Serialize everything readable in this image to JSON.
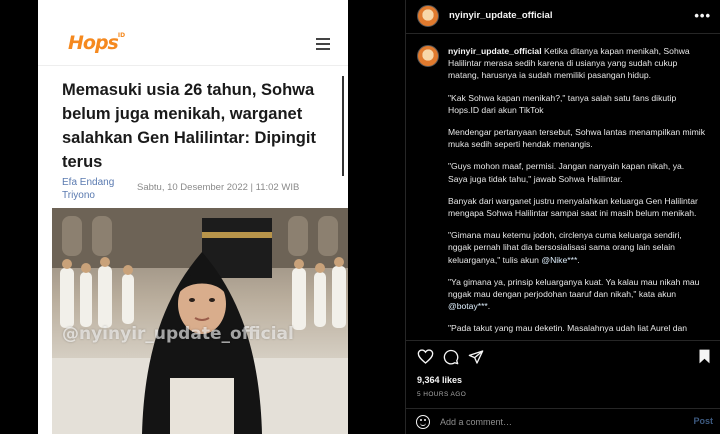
{
  "article": {
    "logo": "Hops",
    "logo_sup": "ID",
    "headline": "Memasuki usia 26 tahun, Sohwa belum juga menikah, warganet salahkan Gen Halilintar: Dipingit terus",
    "author": "Efa Endang Triyono",
    "date": "Sabtu, 10 Desember 2022 | 11:02 WIB",
    "watermark": "@nyinyir_update_official"
  },
  "post": {
    "username": "nyinyir_update_official",
    "caption_user": "nyinyir_update_official",
    "p1": "Ketika ditanya kapan menikah, Sohwa Halilintar merasa sedih karena di usianya yang sudah cukup matang, harusnya ia sudah memiliki pasangan hidup.",
    "p2": "\"Kak Sohwa kapan menikah?,\" tanya salah satu fans dikutip Hops.ID dari akun TikTok",
    "p3": "Mendengar pertanyaan tersebut, Sohwa lantas menampilkan mimik muka sedih seperti hendak menangis.",
    "p4": "\"Guys mohon maaf, permisi. Jangan nanyain kapan nikah, ya. Saya juga tidak tahu,\" jawab Sohwa Halilintar.",
    "p5": "Banyak dari warganet justru menyalahkan keluarga Gen Halilintar mengapa Sohwa Halilintar sampai saat ini masih belum menikah.",
    "p6": "\"Gimana mau ketemu jodoh, circlenya cuma keluarga sendiri, nggak pernah lihat dia bersosialisasi sama orang lain selain keluarganya,\" tulis akun",
    "p6_mention": "@Nike***",
    "p6_end": ".",
    "p7": "\"Ya gimana ya, prinsip keluarganya kuat. Ya kalau mau nikah mau nggak mau dengan perjodohan taaruf dan nikah,\" kata akun",
    "p7_mention": "@botay***",
    "p7_end": ".",
    "p8": "\"Pada takut yang mau deketin. Masalahnya udah liat Aurel dan",
    "likes": "9,364 likes",
    "time": "5 HOURS AGO",
    "comment_placeholder": "Add a comment…",
    "post_label": "Post",
    "more_label": "•••"
  }
}
